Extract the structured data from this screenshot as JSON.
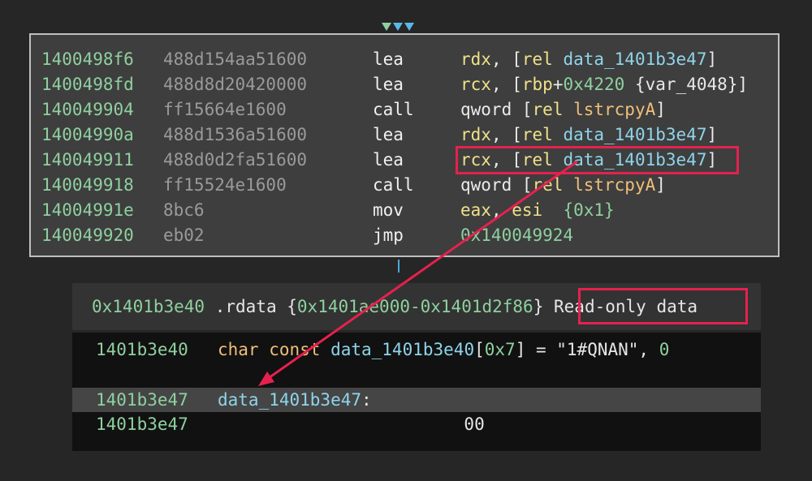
{
  "disassembly": [
    {
      "addr": "1400498f6",
      "bytes": "488d154aa51600",
      "mnemonic": "lea",
      "ops": [
        {
          "t": "reg",
          "s": "rdx"
        },
        {
          "t": "pun",
          "s": ", ["
        },
        {
          "t": "reg",
          "s": "rel "
        },
        {
          "t": "dat",
          "s": "data_1401b3e47"
        },
        {
          "t": "pun",
          "s": "]"
        }
      ]
    },
    {
      "addr": "1400498fd",
      "bytes": "488d8d20420000",
      "mnemonic": "lea",
      "ops": [
        {
          "t": "reg",
          "s": "rcx"
        },
        {
          "t": "pun",
          "s": ", ["
        },
        {
          "t": "reg",
          "s": "rbp"
        },
        {
          "t": "pun",
          "s": "+"
        },
        {
          "t": "num",
          "s": "0x4220"
        },
        {
          "t": "pun",
          "s": " "
        },
        {
          "t": "var",
          "s": "{var_4048}"
        },
        {
          "t": "pun",
          "s": "]"
        }
      ]
    },
    {
      "addr": "140049904",
      "bytes": "ff15664e1600",
      "mnemonic": "call",
      "ops": [
        {
          "t": "pun",
          "s": "qword ["
        },
        {
          "t": "reg",
          "s": "rel "
        },
        {
          "t": "imp",
          "s": "lstrcpyA"
        },
        {
          "t": "pun",
          "s": "]"
        }
      ]
    },
    {
      "addr": "14004990a",
      "bytes": "488d1536a51600",
      "mnemonic": "lea",
      "ops": [
        {
          "t": "reg",
          "s": "rdx"
        },
        {
          "t": "pun",
          "s": ", ["
        },
        {
          "t": "reg",
          "s": "rel "
        },
        {
          "t": "dat",
          "s": "data_1401b3e47"
        },
        {
          "t": "pun",
          "s": "]"
        }
      ]
    },
    {
      "addr": "140049911",
      "bytes": "488d0d2fa51600",
      "mnemonic": "lea",
      "ops": [
        {
          "t": "reg",
          "s": "rcx"
        },
        {
          "t": "pun",
          "s": ", ["
        },
        {
          "t": "reg",
          "s": "rel "
        },
        {
          "t": "dat",
          "s": "data_1401b3e47"
        },
        {
          "t": "pun",
          "s": "]"
        }
      ]
    },
    {
      "addr": "140049918",
      "bytes": "ff15524e1600",
      "mnemonic": "call",
      "ops": [
        {
          "t": "pun",
          "s": "qword ["
        },
        {
          "t": "reg",
          "s": "rel "
        },
        {
          "t": "imp",
          "s": "lstrcpyA"
        },
        {
          "t": "pun",
          "s": "]"
        }
      ]
    },
    {
      "addr": "14004991e",
      "bytes": "8bc6",
      "mnemonic": "mov",
      "ops": [
        {
          "t": "reg",
          "s": "eax"
        },
        {
          "t": "pun",
          "s": ", "
        },
        {
          "t": "reg",
          "s": "esi"
        },
        {
          "t": "pun",
          "s": "  "
        },
        {
          "t": "num",
          "s": "{0x1}"
        }
      ]
    },
    {
      "addr": "140049920",
      "bytes": "eb02",
      "mnemonic": "jmp",
      "ops": [
        {
          "t": "num",
          "s": "0x140049924"
        }
      ]
    }
  ],
  "section": {
    "addr": "0x1401b3e40",
    "name": ".rdata",
    "range_open": "{",
    "range": "0x1401ae000-0x1401d2f86",
    "range_close": "}",
    "description": "Read-only data"
  },
  "data_rows": [
    {
      "addr": "1401b3e40",
      "body": [
        {
          "t": "kw",
          "s": "char const "
        },
        {
          "t": "dat",
          "s": "data_1401b3e40"
        },
        {
          "t": "str",
          "s": "["
        },
        {
          "t": "num",
          "s": "0x7"
        },
        {
          "t": "str",
          "s": "] = \"1#QNAN\", "
        },
        {
          "t": "num",
          "s": "0"
        }
      ]
    },
    {
      "addr": "",
      "body": []
    },
    {
      "addr": "1401b3e47",
      "selected": true,
      "body": [
        {
          "t": "dat",
          "s": "data_1401b3e47"
        },
        {
          "t": "str",
          "s": ":"
        }
      ]
    },
    {
      "addr": "1401b3e47",
      "body": [
        {
          "t": "str",
          "s": "                        00"
        }
      ]
    }
  ],
  "colors": {
    "highlight": "#e5214d",
    "arrow": "#e5214d",
    "address": "#8fd0a0",
    "data_symbol": "#8fd4ea",
    "import_symbol": "#f0bf7a",
    "register": "#efe08a"
  }
}
